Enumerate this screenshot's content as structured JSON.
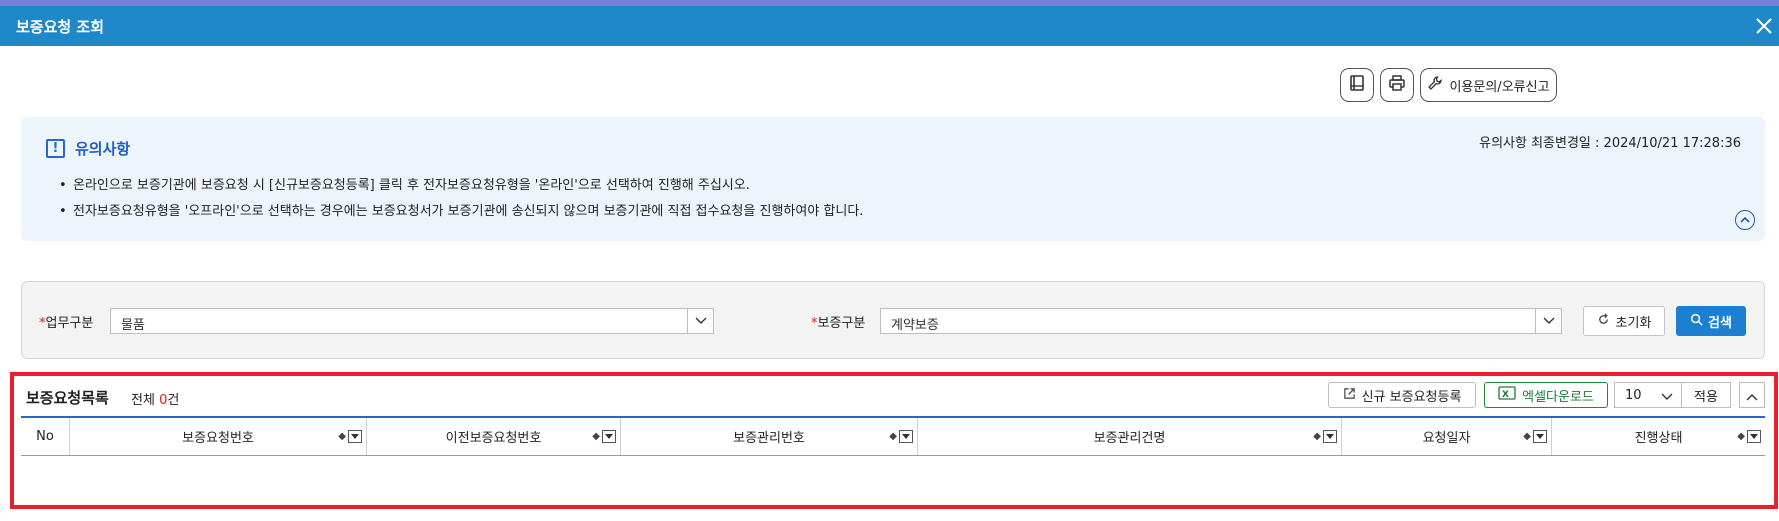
{
  "window": {
    "title": "보증요청 조회"
  },
  "toolbar": {
    "manual_label": "",
    "print_label": "",
    "inquiry_label": "이용문의/오류신고"
  },
  "notice": {
    "heading": "유의사항",
    "updated": "유의사항 최종변경일 : 2024/10/21 17:28:36",
    "items": [
      "온라인으로 보증기관에 보증요청 시 [신규보증요청등록] 클릭 후 전자보증요청유형을 '온라인'으로 선택하여 진행해 주십시오.",
      "전자보증요청유형을 '오프라인'으로 선택하는 경우에는 보증요청서가 보증기관에 송신되지 않으며 보증기관에 직접 접수요청을 진행하여야 합니다."
    ]
  },
  "search": {
    "required_mark": "*",
    "work_type_label": "업무구분",
    "work_type_value": "물품",
    "guarantee_type_label": "보증구분",
    "guarantee_type_value": "계약보증",
    "reset_label": "초기화",
    "search_label": "검색"
  },
  "list": {
    "title": "보증요청목록",
    "count_prefix": "전체 ",
    "count": "0",
    "count_suffix": "건",
    "new_label": "신규 보증요청등록",
    "excel_label": "엑셀다운로드",
    "page_size": "10",
    "apply_label": "적용",
    "columns": [
      "No",
      "보증요청번호",
      "이전보증요청번호",
      "보증관리번호",
      "보증관리건명",
      "요청일자",
      "진행상태"
    ]
  },
  "colors": {
    "titlebar": "#1e88c8",
    "accent": "#2a66c8",
    "required": "#e02020",
    "excel": "#1e7a34",
    "highlight_box": "#e8202a"
  }
}
